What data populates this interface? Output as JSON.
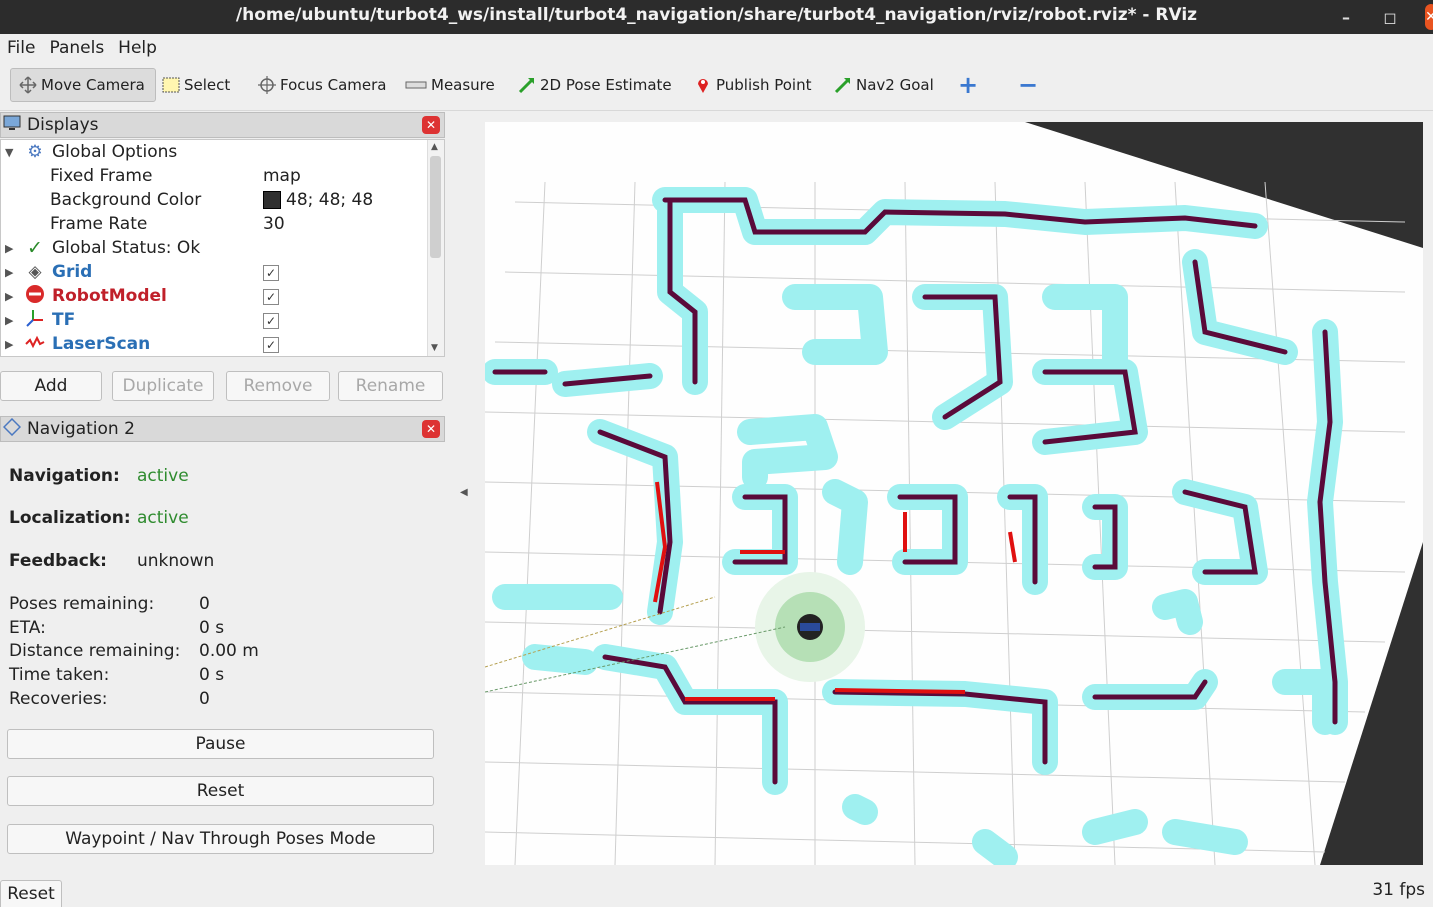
{
  "window": {
    "title": "/home/ubuntu/turbot4_ws/install/turbot4_navigation/share/turbot4_navigation/rviz/robot.rviz* - RViz",
    "minimize_glyph": "–",
    "maximize_glyph": "◻",
    "close_glyph": "✕"
  },
  "menu": {
    "file": "File",
    "panels": "Panels",
    "help": "Help"
  },
  "toolbar": {
    "move_camera": "Move Camera",
    "select": "Select",
    "focus_camera": "Focus Camera",
    "measure": "Measure",
    "pose_estimate": "2D Pose Estimate",
    "publish_point": "Publish Point",
    "nav2_goal": "Nav2 Goal",
    "add_glyph": "+",
    "remove_glyph": "−"
  },
  "displays": {
    "title": "Displays",
    "items": {
      "global_options": "Global Options",
      "fixed_frame_label": "Fixed Frame",
      "fixed_frame_value": "map",
      "bg_color_label": "Background Color",
      "bg_color_value": "48; 48; 48",
      "frame_rate_label": "Frame Rate",
      "frame_rate_value": "30",
      "global_status": "Global Status: Ok",
      "grid": "Grid",
      "robot_model": "RobotModel",
      "tf": "TF",
      "laser_scan": "LaserScan"
    },
    "buttons": {
      "add": "Add",
      "duplicate": "Duplicate",
      "remove": "Remove",
      "rename": "Rename"
    }
  },
  "navigation": {
    "title": "Navigation 2",
    "navigation_label": "Navigation:",
    "navigation_value": "active",
    "localization_label": "Localization:",
    "localization_value": "active",
    "feedback_label": "Feedback:",
    "feedback_value": "unknown",
    "poses_remaining_label": "Poses remaining:",
    "poses_remaining_value": "0",
    "eta_label": "ETA:",
    "eta_value": "0 s",
    "distance_label": "Distance remaining:",
    "distance_value": "0.00 m",
    "time_label": "Time taken:",
    "time_value": "0 s",
    "recoveries_label": "Recoveries:",
    "recoveries_value": "0",
    "pause": "Pause",
    "reset": "Reset",
    "waypoint_mode": "Waypoint / Nav Through Poses Mode"
  },
  "bottom": {
    "reset": "Reset",
    "fps": "31 fps"
  },
  "colors": {
    "active_green": "#2e8b2e",
    "map_wall": "#5a0a3a",
    "map_inflation": "#9ff0f0",
    "laser_red": "#e01010",
    "status_check": "#2a8a2a",
    "grid_blue": "#2a6fb5",
    "robot_red": "#c0202a"
  }
}
